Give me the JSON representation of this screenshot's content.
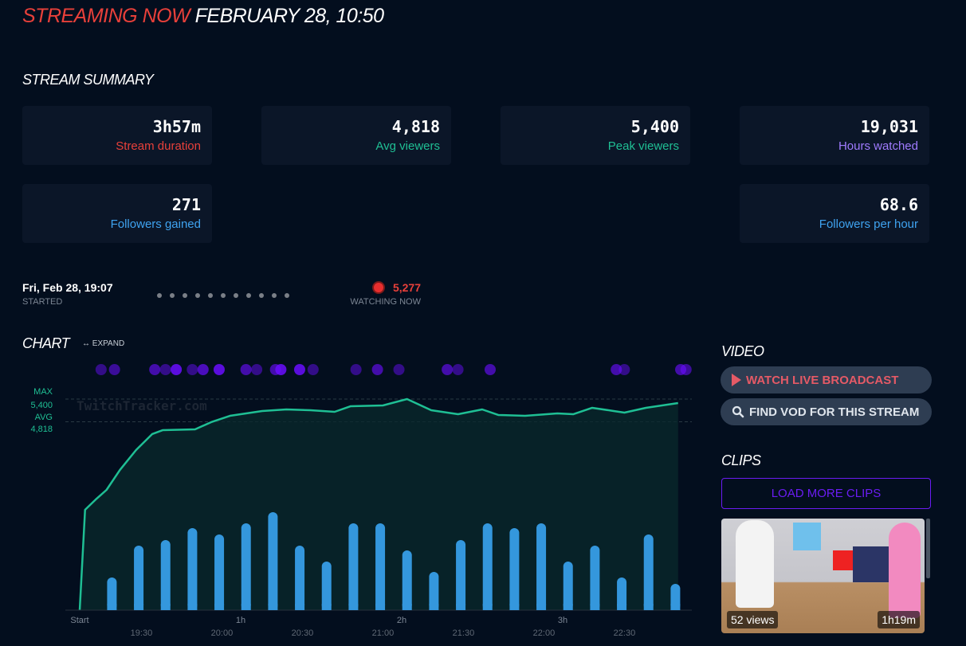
{
  "header": {
    "live_label": "STREAMING NOW",
    "datetime": "FEBRUARY 28, 10:50"
  },
  "summary": {
    "title": "STREAM SUMMARY",
    "cards": [
      {
        "value": "3h57m",
        "label": "Stream duration",
        "color": "#e8403a"
      },
      {
        "value": "4,818",
        "label": "Avg viewers",
        "color": "#1fbf94"
      },
      {
        "value": "5,400",
        "label": "Peak viewers",
        "color": "#1fbf94"
      },
      {
        "value": "19,031",
        "label": "Hours watched",
        "color": "#a07bff"
      },
      {
        "value": "271",
        "label": "Followers gained",
        "color": "#3fa3f0"
      },
      {
        "value": "68.6",
        "label": "Followers per hour",
        "color": "#3fa3f0"
      }
    ]
  },
  "timeline": {
    "started_value": "Fri, Feb 28, 19:07",
    "started_label": "STARTED",
    "watching_value": "5,277",
    "watching_label": "WATCHING NOW"
  },
  "chart_section": {
    "title": "CHART",
    "expand_label": "EXPAND",
    "watermark": "TwitchTracker.com"
  },
  "chart_data": {
    "type": "line",
    "max_label": "MAX",
    "max_value": 5400,
    "max_text": "5,400",
    "avg_label": "AVG",
    "avg_value": 4818,
    "avg_text": "4,818",
    "ylim": [
      0,
      5400
    ],
    "x_minutes_max": 223,
    "viewers": [
      [
        0,
        0
      ],
      [
        2,
        2568
      ],
      [
        6,
        2833
      ],
      [
        10,
        3077
      ],
      [
        15,
        3587
      ],
      [
        21,
        4096
      ],
      [
        27,
        4504
      ],
      [
        31,
        4606
      ],
      [
        43,
        4626
      ],
      [
        49,
        4810
      ],
      [
        56,
        4972
      ],
      [
        68,
        5095
      ],
      [
        77,
        5135
      ],
      [
        86,
        5115
      ],
      [
        95,
        5074
      ],
      [
        101,
        5217
      ],
      [
        113,
        5237
      ],
      [
        122,
        5400
      ],
      [
        131,
        5115
      ],
      [
        141,
        5013
      ],
      [
        150,
        5135
      ],
      [
        156,
        4993
      ],
      [
        166,
        4972
      ],
      [
        178,
        5034
      ],
      [
        184,
        5013
      ],
      [
        191,
        5176
      ],
      [
        199,
        5095
      ],
      [
        203,
        5054
      ],
      [
        211,
        5176
      ],
      [
        223,
        5298
      ]
    ],
    "bars": {
      "start_minute": 12,
      "interval_minutes": 10,
      "values": [
        41,
        81,
        88,
        103,
        95,
        109,
        123,
        81,
        61,
        109,
        109,
        75,
        48,
        88,
        109,
        103,
        109,
        61,
        81,
        41,
        95,
        33
      ],
      "max": 123
    },
    "events": [
      {
        "m": 5,
        "o": 0.5
      },
      {
        "m": 10,
        "o": 0.6
      },
      {
        "m": 25,
        "o": 0.7
      },
      {
        "m": 29,
        "o": 0.5
      },
      {
        "m": 33,
        "o": 1
      },
      {
        "m": 39,
        "o": 0.5
      },
      {
        "m": 43,
        "o": 0.8
      },
      {
        "m": 49,
        "o": 1
      },
      {
        "m": 59,
        "o": 0.7
      },
      {
        "m": 63,
        "o": 0.5
      },
      {
        "m": 70,
        "o": 0.7
      },
      {
        "m": 72,
        "o": 1
      },
      {
        "m": 79,
        "o": 1
      },
      {
        "m": 84,
        "o": 0.5
      },
      {
        "m": 100,
        "o": 0.5
      },
      {
        "m": 108,
        "o": 0.7
      },
      {
        "m": 116,
        "o": 0.5
      },
      {
        "m": 134,
        "o": 0.7
      },
      {
        "m": 138,
        "o": 0.5
      },
      {
        "m": 150,
        "o": 0.7
      },
      {
        "m": 197,
        "o": 0.7
      },
      {
        "m": 200,
        "o": 0.5
      },
      {
        "m": 221,
        "o": 0.7
      },
      {
        "m": 223,
        "o": 0.6
      }
    ],
    "x_ticks_top": [
      {
        "m": 0,
        "label": "Start"
      },
      {
        "m": 60,
        "label": "1h"
      },
      {
        "m": 120,
        "label": "2h"
      },
      {
        "m": 180,
        "label": "3h"
      }
    ],
    "x_ticks_bottom": [
      {
        "m": 23,
        "label": "19:30"
      },
      {
        "m": 53,
        "label": "20:00"
      },
      {
        "m": 83,
        "label": "20:30"
      },
      {
        "m": 113,
        "label": "21:00"
      },
      {
        "m": 143,
        "label": "21:30"
      },
      {
        "m": 173,
        "label": "22:00"
      },
      {
        "m": 203,
        "label": "22:30"
      }
    ],
    "colors": {
      "line": "#1fbf94",
      "bar": "#3497dd",
      "event": "#6a0dff"
    }
  },
  "video": {
    "title": "VIDEO",
    "watch_label": "WATCH LIVE BROADCAST",
    "vod_label": "FIND VOD FOR THIS STREAM"
  },
  "clips": {
    "title": "CLIPS",
    "load_more_label": "LOAD MORE CLIPS",
    "items": [
      {
        "views": "52 views",
        "duration": "1h19m"
      }
    ]
  }
}
